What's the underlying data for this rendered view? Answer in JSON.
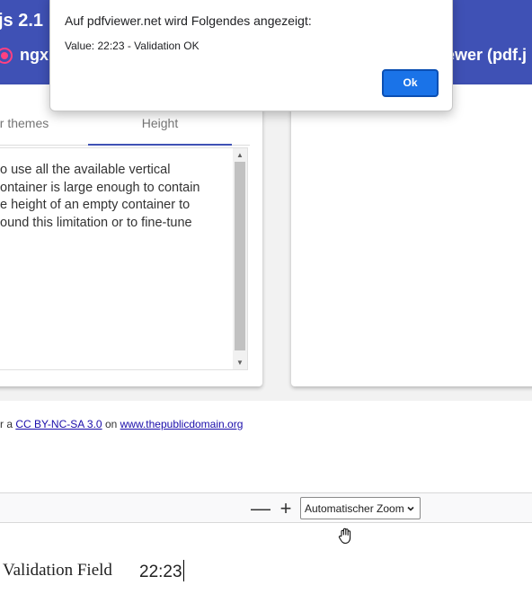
{
  "header": {
    "title": "js 2.1",
    "subtitle_left": "ngx",
    "subtitle_right": "ewer (pdf.j"
  },
  "tabs": [
    {
      "label": "or themes"
    },
    {
      "label": "Height"
    }
  ],
  "content": {
    "lines": [
      "o use all the available vertical",
      "ontainer is large enough to contain",
      "e height of an empty container to",
      "ound this limitation or to fine-tune"
    ]
  },
  "credit": {
    "prefix": "r a ",
    "license_link": "CC BY-NC-SA 3.0",
    "middle": " on ",
    "site_link": "www.thepublicdomain.org"
  },
  "toolbar": {
    "zoom_out_label": "—",
    "zoom_in_label": "+",
    "zoom_value": "Automatischer Zoom"
  },
  "pdf_form": {
    "field_label": "Validation Field",
    "field_value": "22:23"
  },
  "dialog": {
    "title": "Auf pdfviewer.net wird Folgendes angezeigt:",
    "message": "Value: 22:23 - Validation OK",
    "ok_label": "Ok"
  },
  "colors": {
    "header": "#3f51b5",
    "accent": "#ff4081",
    "dialog_button": "#1a73e8"
  },
  "icons": {
    "radio": "radio-icon",
    "hand": "hand-icon",
    "dropdown": "chevron-down-icon"
  }
}
